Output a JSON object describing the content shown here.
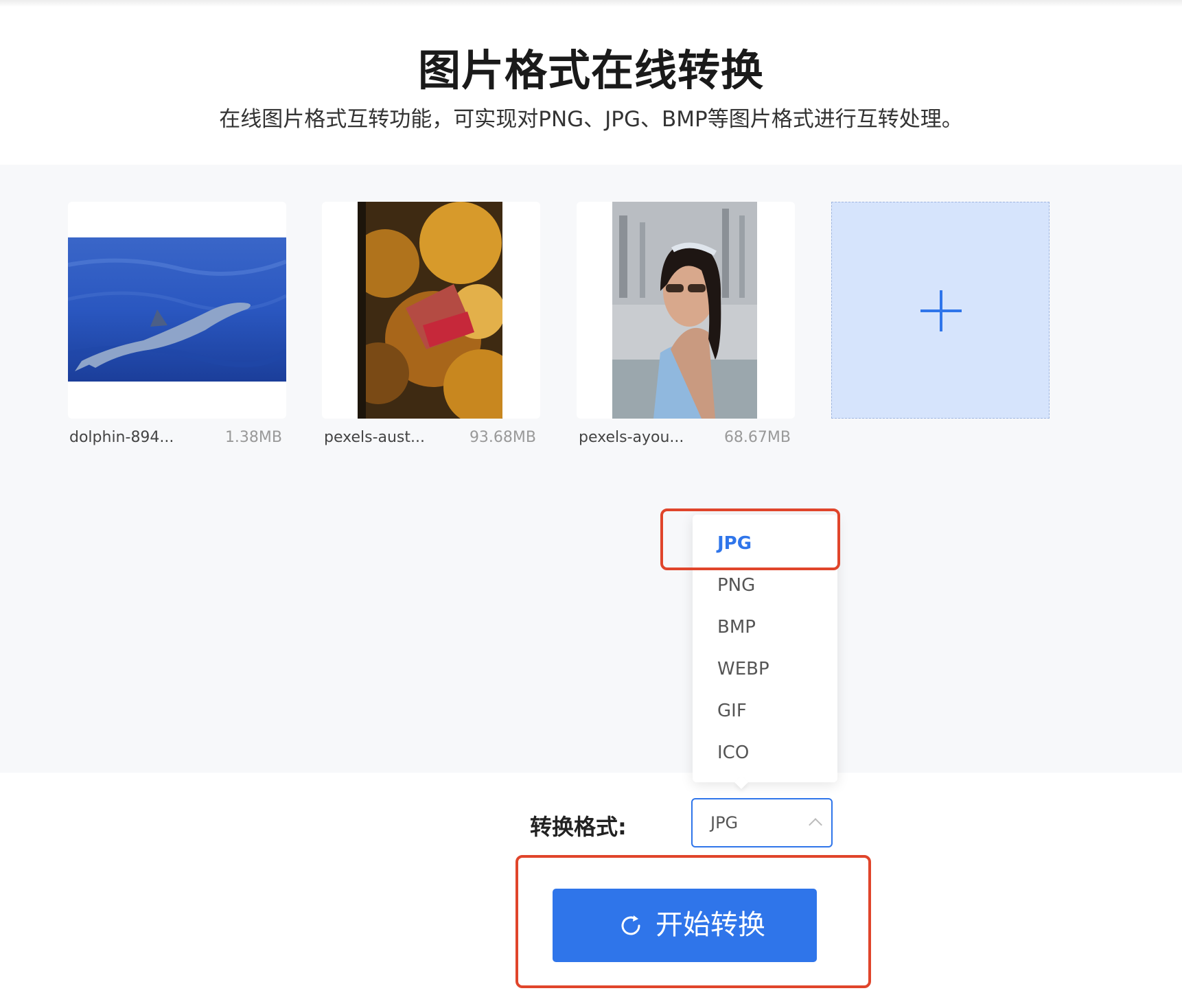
{
  "page": {
    "title": "图片格式在线转换",
    "subtitle": "在线图片格式互转功能，可实现对PNG、JPG、BMP等图片格式进行互转处理。"
  },
  "files": [
    {
      "name": "dolphin-894...",
      "size": "1.38MB"
    },
    {
      "name": "pexels-aust...",
      "size": "93.68MB"
    },
    {
      "name": "pexels-ayou...",
      "size": "68.67MB"
    }
  ],
  "add_button": {
    "icon": "plus-icon"
  },
  "format_dropdown": {
    "options": [
      "JPG",
      "PNG",
      "BMP",
      "WEBP",
      "GIF",
      "ICO"
    ],
    "selected": "JPG"
  },
  "convert_form": {
    "label": "转换格式:",
    "selected_value": "JPG",
    "start_button_label": "开始转换"
  },
  "colors": {
    "accent": "#2f75ea",
    "highlight_box": "#e0452b",
    "upload_area_bg": "#f7f8fa",
    "add_card_bg": "#d6e4fc"
  }
}
